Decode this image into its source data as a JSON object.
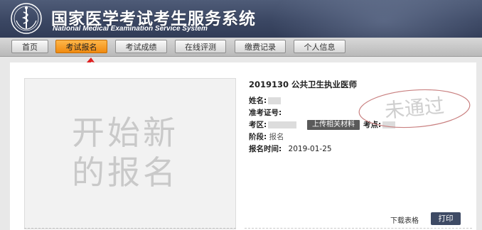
{
  "header": {
    "title": "国家医学考试考生服务系统",
    "subtitle": "National Medical Examination Service System"
  },
  "nav": {
    "items": [
      {
        "label": "首页",
        "active": false
      },
      {
        "label": "考试报名",
        "active": true
      },
      {
        "label": "考试成绩",
        "active": false
      },
      {
        "label": "在线评测",
        "active": false
      },
      {
        "label": "缴费记录",
        "active": false
      },
      {
        "label": "个人信息",
        "active": false
      }
    ]
  },
  "new_registration": {
    "label": "开始新\n的报名"
  },
  "exam": {
    "title": "2019130 公共卫生执业医师",
    "name_label": "姓名:",
    "ticket_label": "准考证号:",
    "area_label": "考区:",
    "upload_button": "上传相关材料",
    "site_label": "考点:",
    "stage_label": "阶段:",
    "stage_value": "报名",
    "reg_time_label": "报名时间:",
    "reg_time_value": "2019-01-25",
    "status_stamp": "未通过"
  },
  "actions": {
    "download_label": "下载表格",
    "print_label": "打印"
  },
  "colors": {
    "header_bg": "#3b4763",
    "active_tab": "#f08a10",
    "arrow": "#e02020",
    "stamp": "#c98080",
    "print_button": "#3e4a64"
  },
  "icons": {
    "logo": "medical-emblem-icon",
    "arrow": "red-arrow-icon"
  }
}
